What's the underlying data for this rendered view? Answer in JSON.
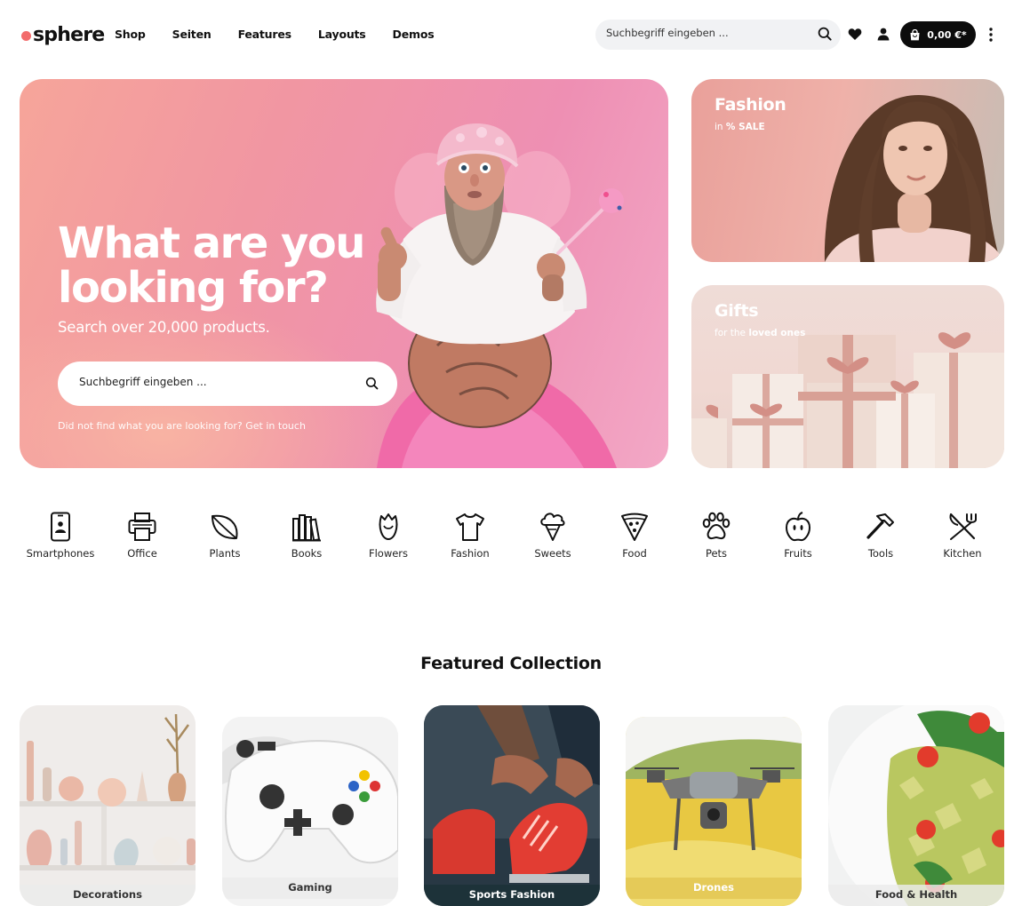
{
  "header": {
    "logo": "sphere",
    "nav": [
      "Shop",
      "Seiten",
      "Features",
      "Layouts",
      "Demos"
    ],
    "search_placeholder": "Suchbegriff eingeben ...",
    "cart_total": "0,00 €*"
  },
  "hero": {
    "title": "What are you\nlooking for?",
    "subtitle": "Search over 20,000 products.",
    "search_placeholder": "Suchbegriff eingeben ...",
    "help_text": "Did not find what you are looking for? Get in touch"
  },
  "promos": {
    "fashion": {
      "title": "Fashion",
      "sub_pre": "in ",
      "sub_bold": "% SALE"
    },
    "gifts": {
      "title": "Gifts",
      "sub_pre": "for the ",
      "sub_bold": "loved ones"
    }
  },
  "categories": [
    {
      "label": "Smartphones",
      "icon": "smartphone-icon"
    },
    {
      "label": "Office",
      "icon": "printer-icon"
    },
    {
      "label": "Plants",
      "icon": "leaf-icon"
    },
    {
      "label": "Books",
      "icon": "books-icon"
    },
    {
      "label": "Flowers",
      "icon": "rose-icon"
    },
    {
      "label": "Fashion",
      "icon": "tshirt-icon"
    },
    {
      "label": "Sweets",
      "icon": "ice-cream-icon"
    },
    {
      "label": "Food",
      "icon": "pizza-icon"
    },
    {
      "label": "Pets",
      "icon": "paw-icon"
    },
    {
      "label": "Fruits",
      "icon": "apple-icon"
    },
    {
      "label": "Tools",
      "icon": "hammer-icon"
    },
    {
      "label": "Kitchen",
      "icon": "cutlery-icon"
    }
  ],
  "featured": {
    "title": "Featured Collection",
    "tiles": [
      "Decorations",
      "Gaming",
      "Sports Fashion",
      "Drones",
      "Food & Health"
    ]
  }
}
